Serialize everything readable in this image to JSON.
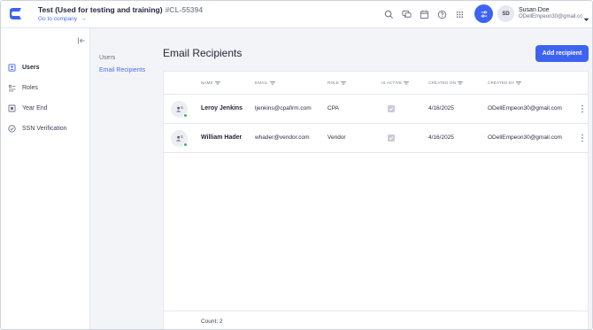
{
  "header": {
    "company_title": "Test (Used for testing and training)",
    "company_code": "#CL-55394",
    "goto_label": "Go to company",
    "goto_arrow": "→",
    "icons": [
      "search-icon",
      "chat-icon",
      "calendar-icon",
      "help-icon",
      "apps-grid-icon",
      "filter-settings-icon"
    ],
    "user": {
      "initials": "SD",
      "name": "Susan Doe",
      "email": "ODellEmpeon30@gmail.cc"
    }
  },
  "sidebar": {
    "items": [
      {
        "label": "Users",
        "icon": "users-icon",
        "active": true
      },
      {
        "label": "Roles",
        "icon": "roles-icon",
        "active": false
      },
      {
        "label": "Year End",
        "icon": "year-end-icon",
        "active": false
      },
      {
        "label": "SSN Verification",
        "icon": "ssn-verification-icon",
        "active": false
      }
    ]
  },
  "subnav": {
    "items": [
      {
        "label": "Users",
        "active": false
      },
      {
        "label": "Email Recipients",
        "active": true
      }
    ]
  },
  "main": {
    "title": "Email Recipients",
    "add_button": "Add recipient",
    "columns": [
      "NAME",
      "EMAIL",
      "ROLE",
      "IS ACTIVE",
      "CREATED ON",
      "CREATED BY"
    ],
    "rows": [
      {
        "name": "Leroy Jenkins",
        "email": "ljenkins@cpafirm.com",
        "role": "CPA",
        "is_active": true,
        "created_on": "4/16/2025",
        "created_by": "ODellEmpeon30@gmail.com"
      },
      {
        "name": "William Hader",
        "email": "whader@vendor.com",
        "role": "Vendor",
        "is_active": true,
        "created_on": "4/16/2025",
        "created_by": "ODellEmpeon30@gmail.com"
      }
    ],
    "count_label": "Count: 2"
  },
  "colors": {
    "accent": "#3d63f0",
    "link": "#4a6cf7",
    "online": "#2fb36a"
  }
}
